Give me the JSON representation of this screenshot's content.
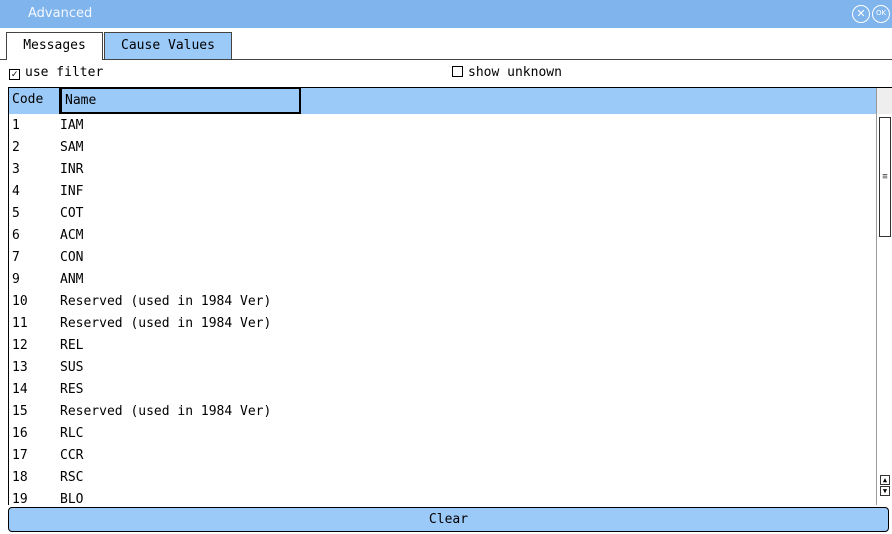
{
  "window": {
    "title": "Advanced",
    "close_icon": "close-icon",
    "ok_icon": "ok-icon",
    "ok_label": "OK"
  },
  "tabs": [
    {
      "label": "Messages",
      "active": true
    },
    {
      "label": "Cause Values",
      "active": false
    }
  ],
  "options": {
    "use_filter": {
      "label": "use filter",
      "checked": true
    },
    "show_unknown": {
      "label": "show unknown",
      "checked": false
    }
  },
  "table": {
    "columns": [
      "Code",
      "Name"
    ],
    "rows": [
      {
        "code": "1",
        "name": "IAM"
      },
      {
        "code": "2",
        "name": "SAM"
      },
      {
        "code": "3",
        "name": "INR"
      },
      {
        "code": "4",
        "name": "INF"
      },
      {
        "code": "5",
        "name": "COT"
      },
      {
        "code": "6",
        "name": "ACM"
      },
      {
        "code": "7",
        "name": "CON"
      },
      {
        "code": "9",
        "name": "ANM"
      },
      {
        "code": "10",
        "name": "Reserved (used in 1984 Ver)"
      },
      {
        "code": "11",
        "name": "Reserved (used in 1984 Ver)"
      },
      {
        "code": "12",
        "name": "REL"
      },
      {
        "code": "13",
        "name": "SUS"
      },
      {
        "code": "14",
        "name": "RES"
      },
      {
        "code": "15",
        "name": "Reserved (used in 1984 Ver)"
      },
      {
        "code": "16",
        "name": "RLC"
      },
      {
        "code": "17",
        "name": "CCR"
      },
      {
        "code": "18",
        "name": "RSC"
      },
      {
        "code": "19",
        "name": "BLO"
      }
    ]
  },
  "scrollbar": {
    "thumb_glyph": "≡"
  },
  "buttons": {
    "clear_label": "Clear"
  },
  "colors": {
    "accent": "#7fb4ec",
    "header": "#9ccaf8"
  }
}
